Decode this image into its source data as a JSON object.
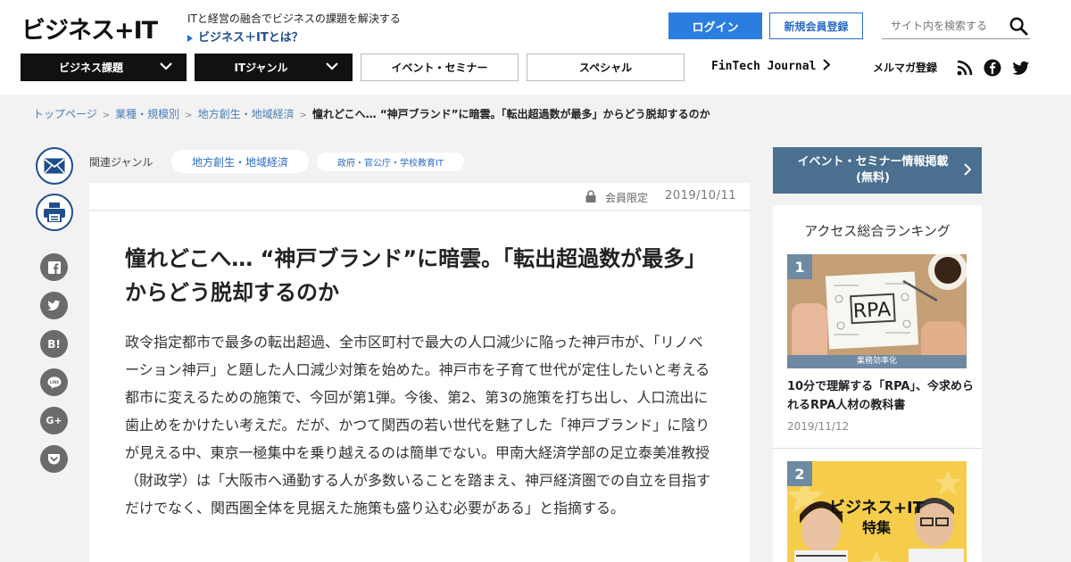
{
  "header": {
    "logo": "ビジネス+IT",
    "tagline": "ITと経営の融合でビジネスの課題を解決する",
    "about_link": "ビジネス＋ITとは？",
    "login": "ログイン",
    "register": "新規会員登録",
    "search_placeholder": "サイト内を検索する"
  },
  "nav": {
    "business": "ビジネス課題",
    "it_genre": "ITジャンル",
    "events": "イベント・セミナー",
    "special": "スペシャル",
    "fintech": "FinTech Journal",
    "mailmag": "メルマガ登録"
  },
  "breadcrumb": {
    "home": "トップページ",
    "industry": "業種・規模別",
    "region": "地方創生・地域経済",
    "current": "憧れどこへ… “神戸ブランド”に暗雲。「転出超過数が最多」からどう脱却するのか"
  },
  "genre": {
    "label": "関連ジャンル",
    "tags": [
      "地方創生・地域経済",
      "政府・官公庁・学校教育IT"
    ]
  },
  "article": {
    "members_only": "会員限定",
    "date": "2019/10/11",
    "title": "憧れどこへ… “神戸ブランド”に暗雲。「転出超過数が最多」からどう脱却するのか",
    "lead": "政令指定都市で最多の転出超過、全市区町村で最大の人口減少に陥った神戸市が、「リノベーション神戸」と題した人口減少対策を始めた。神戸市を子育て世代が定住したいと考える都市に変えるための施策で、今回が第1弾。今後、第2、第3の施策を打ち出し、人口流出に歯止めをかけたい考えだ。だが、かつて関西の若い世代を魅了した「神戸ブランド」に陰りが見える中、東京一極集中を乗り越えるのは簡単でない。甲南大経済学部の足立泰美准教授（財政学）は「大阪市へ通勤する人が多数いることを踏まえ、神戸経済圏での自立を目指すだけでなく、関西圏全体を見据えた施策も盛り込む必要がある」と指摘する。"
  },
  "share": {
    "hatena": "B!",
    "googleplus": "G+",
    "line": "LINE"
  },
  "sidebar": {
    "event_button_line1": "イベント・セミナー情報掲載",
    "event_button_line2": "(無料)",
    "ranking_title": "アクセス総合ランキング",
    "items": [
      {
        "rank": "1",
        "category": "業務効率化",
        "image_text": "RPA",
        "title": "10分で理解する「RPA」、今求められるRPA人材の教科書",
        "date": "2019/11/12"
      },
      {
        "rank": "2",
        "image_text_1": "ビジネス+IT",
        "image_text_2": "特集"
      }
    ]
  },
  "colors": {
    "primary_blue": "#2b7de0",
    "dark_nav": "#111111",
    "slate": "#4a6f8f",
    "link": "#4a7fb8"
  }
}
